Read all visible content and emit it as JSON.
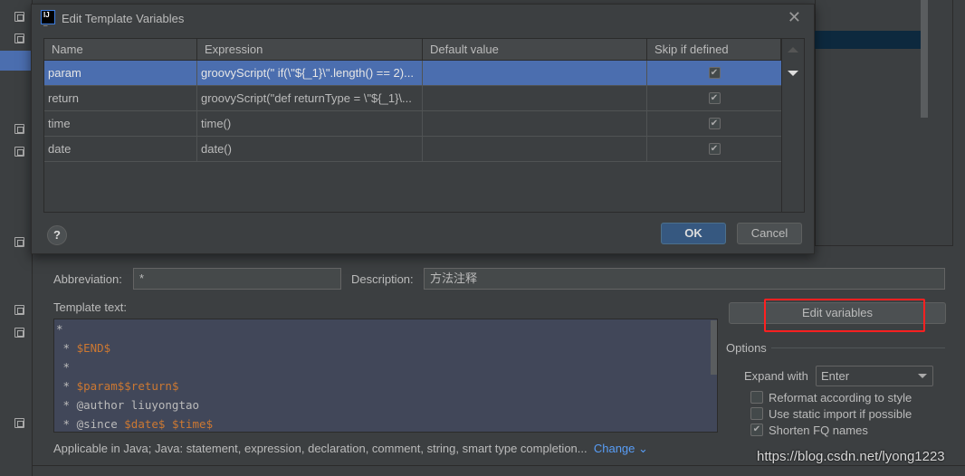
{
  "dialog": {
    "title": "Edit Template Variables",
    "columns": [
      "Name",
      "Expression",
      "Default value",
      "Skip if defined"
    ],
    "rows": [
      {
        "name": "param",
        "expression": "groovyScript(\" if(\\\"${_1}\\\".length() == 2)...",
        "default": "",
        "skip": true,
        "selected": true
      },
      {
        "name": "return",
        "expression": "groovyScript(\"def returnType = \\\"${_1}\\...",
        "default": "",
        "skip": true,
        "selected": false
      },
      {
        "name": "time",
        "expression": "time()",
        "default": "",
        "skip": true,
        "selected": false
      },
      {
        "name": "date",
        "expression": "date()",
        "default": "",
        "skip": true,
        "selected": false
      }
    ],
    "help_label": "?",
    "ok_label": "OK",
    "cancel_label": "Cancel"
  },
  "form": {
    "abbreviation_label": "Abbreviation:",
    "abbreviation_value": "*",
    "description_label": "Description:",
    "description_value": "方法注释",
    "template_label": "Template text:",
    "template_lines": [
      "*",
      " * $END$",
      " *",
      " * $param$$return$",
      " * @author liuyongtao",
      " * @since $date$ $time$"
    ],
    "applicable_text": "Applicable in Java; Java: statement, expression, declaration, comment, string, smart type completion...",
    "change_link": "Change",
    "edit_variables_label": "Edit variables",
    "options_label": "Options",
    "expand_with_label": "Expand with",
    "expand_with_value": "Enter",
    "checkboxes": [
      {
        "label": "Reformat according to style",
        "checked": false
      },
      {
        "label": "Use static import if possible",
        "checked": false
      },
      {
        "label": "Shorten FQ names",
        "checked": true
      }
    ]
  },
  "watermark": "https://blog.csdn.net/lyong1223",
  "colors": {
    "selection": "#4b6eaf",
    "accent_link": "#589df6",
    "highlight_box": "#ff2020",
    "template_var": "#cc7832"
  }
}
